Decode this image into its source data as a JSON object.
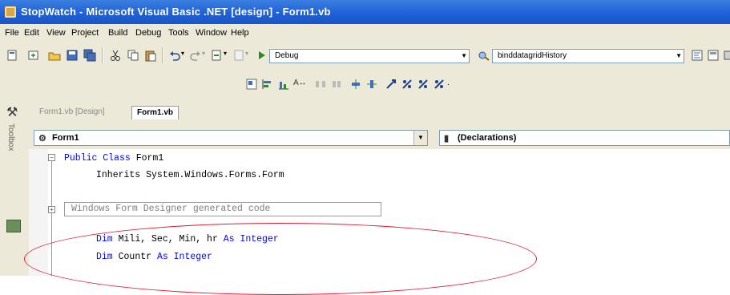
{
  "window": {
    "title": "StopWatch - Microsoft Visual Basic .NET [design] - Form1.vb"
  },
  "menu": {
    "items": [
      "File",
      "Edit",
      "View",
      "Project",
      "Build",
      "Debug",
      "Tools",
      "Window",
      "Help"
    ]
  },
  "toolbar": {
    "config_combo": "Debug",
    "project_combo": "binddatagridHistory"
  },
  "sidebar": {
    "toolbox_label": "Toolbox"
  },
  "tabs": [
    {
      "label": "Form1.vb [Design]",
      "active": false
    },
    {
      "label": "Form1.vb",
      "active": true
    }
  ],
  "navigation": {
    "class_combo": "Form1",
    "method_combo": "(Declarations)"
  },
  "code": {
    "line1_kw": "Public Class",
    "line1_name": " Form1",
    "line2_text": "Inherits System.Windows.Forms.Form",
    "region_label": "Windows Form Designer generated code",
    "line4_kw": "Dim",
    "line4_vars": " Mili, Sec, Min, hr ",
    "line4_as": "As Integer",
    "line5_kw": "Dim",
    "line5_var": " Countr ",
    "line5_as": "As Integer"
  },
  "colors": {
    "keyword": "#0000ff",
    "highlight_ellipse": "#e0182d"
  }
}
